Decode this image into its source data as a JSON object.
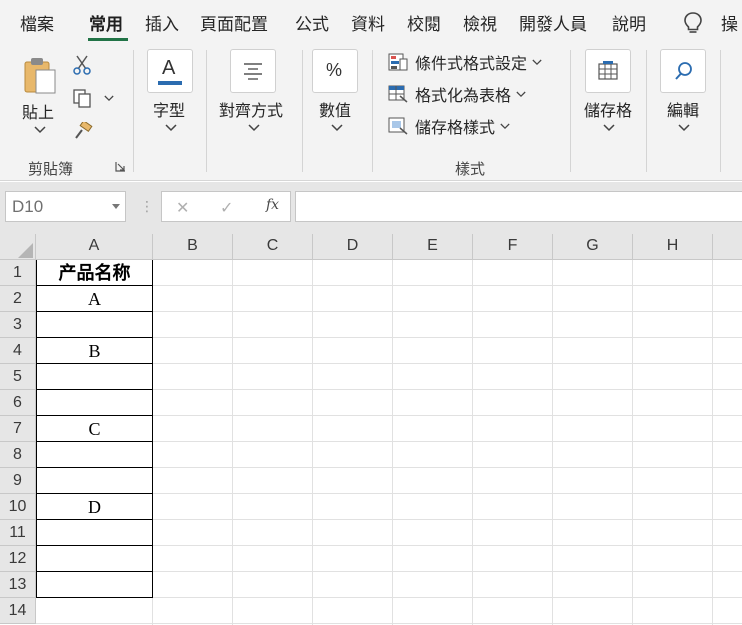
{
  "tabs": [
    {
      "label": "檔案",
      "active": false
    },
    {
      "label": "常用",
      "active": true
    },
    {
      "label": "插入",
      "active": false
    },
    {
      "label": "頁面配置",
      "active": false
    },
    {
      "label": "公式",
      "active": false
    },
    {
      "label": "資料",
      "active": false
    },
    {
      "label": "校閱",
      "active": false
    },
    {
      "label": "檢視",
      "active": false
    },
    {
      "label": "開發人員",
      "active": false
    },
    {
      "label": "說明",
      "active": false
    }
  ],
  "tell_me": {
    "label": "操"
  },
  "ribbon": {
    "clipboard": {
      "paste_label": "貼上",
      "group_label": "剪貼簿"
    },
    "font": {
      "label": "字型",
      "icon_letter": "A"
    },
    "alignment": {
      "label": "對齊方式"
    },
    "number": {
      "label": "數值",
      "icon_text": "%"
    },
    "styles": {
      "conditional_formatting": "條件式格式設定",
      "format_as_table": "格式化為表格",
      "cell_styles": "儲存格樣式",
      "group_label": "樣式"
    },
    "cells": {
      "label": "儲存格"
    },
    "editing": {
      "label": "編輯"
    }
  },
  "formula_bar": {
    "name_box": "D10",
    "cancel": "✕",
    "enter": "✓",
    "fx": "fx",
    "formula": ""
  },
  "sheet": {
    "columns": [
      "A",
      "B",
      "C",
      "D",
      "E",
      "F",
      "G",
      "H"
    ],
    "rows": [
      "1",
      "2",
      "3",
      "4",
      "5",
      "6",
      "7",
      "8",
      "9",
      "10",
      "11",
      "12",
      "13",
      "14"
    ],
    "cells_A": [
      "产品名称",
      "A",
      "",
      "B",
      "",
      "",
      "C",
      "",
      "",
      "D",
      "",
      "",
      ""
    ]
  },
  "colors": {
    "accent": "#217346",
    "ribbon_bg": "#f3f3f3",
    "header_bg": "#e6e6e6"
  }
}
